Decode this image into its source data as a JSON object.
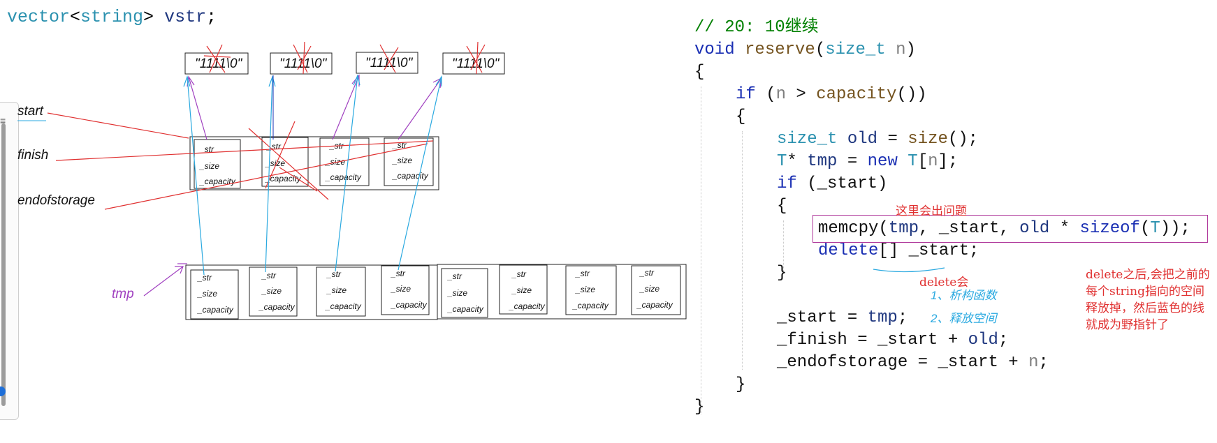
{
  "title": {
    "type": "vector",
    "lt": "<",
    "param": "string",
    "gt": "> ",
    "var": "vstr",
    "semi": ";"
  },
  "labels": {
    "start": "start",
    "finish": "finish",
    "endofstorage": "endofstorage",
    "tmp": "tmp"
  },
  "string_literal": "\"1111\\0\"",
  "cell_fields": [
    "_str",
    "_size",
    "_capacity"
  ],
  "code": {
    "comment": "// 20: 10继续",
    "l1_void": "void",
    "l1_name": "reserve",
    "l1_open": "(",
    "l1_type": "size_t",
    "l1_param": "n",
    "l1_close": ")",
    "brace_open": "{",
    "brace_close": "}",
    "if1_kw": "if",
    "if1_a": " (",
    "if1_n": "n",
    "if1_b": " > ",
    "if1_fn": "capacity",
    "if1_c": "())",
    "old_type": "size_t",
    "old_a": " ",
    "old_var": "old",
    "old_b": " = ",
    "old_fn": "size",
    "old_c": "();",
    "tmp_T": "T",
    "tmp_a": "* ",
    "tmp_var": "tmp",
    "tmp_b": " = ",
    "tmp_new": "new",
    "tmp_c": " ",
    "tmp_T2": "T",
    "tmp_d": "[",
    "tmp_n": "n",
    "tmp_e": "];",
    "if2_kw": "if",
    "if2_a": " (_start)",
    "memcpy_fn": "memcpy",
    "memcpy_a": "(",
    "memcpy_tmp": "tmp",
    "memcpy_b": ", _start, ",
    "memcpy_old": "old",
    "memcpy_c": " * ",
    "memcpy_sizeof": "sizeof",
    "memcpy_d": "(",
    "memcpy_T": "T",
    "memcpy_e": "));",
    "delete_kw": "delete",
    "delete_a": "[] _start;",
    "as1_a": "_start = ",
    "as1_tmp": "tmp",
    "as1_b": ";",
    "as2_a": "_finish = _start + ",
    "as2_old": "old",
    "as2_b": ";",
    "as3_a": "_endofstorage = _start + ",
    "as3_n": "n",
    "as3_b": ";"
  },
  "annotations": {
    "here_problem": "这里会出问题",
    "delete_will": "delete会",
    "step1": "1、析构函数",
    "step2": "2、释放空间",
    "explain": "delete之后,会把之前的每个string指向的空间释放掉，然后蓝色的线就成为野指针了"
  },
  "colors": {
    "red_arrow": "#e03030",
    "blue_arrow": "#2aa9e0",
    "purple_arrow": "#a040c0",
    "keyword": "#1a2fb3",
    "type": "#2b91af",
    "function": "#74531f",
    "param": "#808080",
    "comment": "#008000",
    "highlight_box": "#b03a9c"
  }
}
